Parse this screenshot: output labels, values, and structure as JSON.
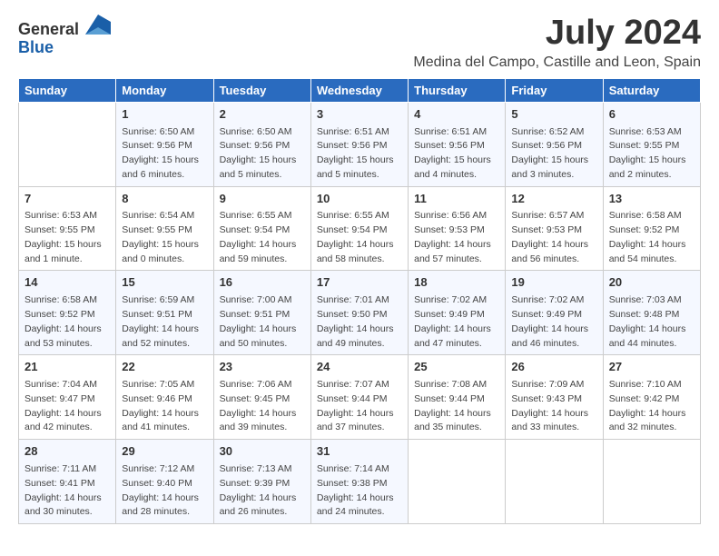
{
  "logo": {
    "general": "General",
    "blue": "Blue"
  },
  "title": "July 2024",
  "location": "Medina del Campo, Castille and Leon, Spain",
  "days_header": [
    "Sunday",
    "Monday",
    "Tuesday",
    "Wednesday",
    "Thursday",
    "Friday",
    "Saturday"
  ],
  "weeks": [
    [
      {
        "day": "",
        "sunrise": "",
        "sunset": "",
        "daylight": ""
      },
      {
        "day": "1",
        "sunrise": "Sunrise: 6:50 AM",
        "sunset": "Sunset: 9:56 PM",
        "daylight": "Daylight: 15 hours and 6 minutes."
      },
      {
        "day": "2",
        "sunrise": "Sunrise: 6:50 AM",
        "sunset": "Sunset: 9:56 PM",
        "daylight": "Daylight: 15 hours and 5 minutes."
      },
      {
        "day": "3",
        "sunrise": "Sunrise: 6:51 AM",
        "sunset": "Sunset: 9:56 PM",
        "daylight": "Daylight: 15 hours and 5 minutes."
      },
      {
        "day": "4",
        "sunrise": "Sunrise: 6:51 AM",
        "sunset": "Sunset: 9:56 PM",
        "daylight": "Daylight: 15 hours and 4 minutes."
      },
      {
        "day": "5",
        "sunrise": "Sunrise: 6:52 AM",
        "sunset": "Sunset: 9:56 PM",
        "daylight": "Daylight: 15 hours and 3 minutes."
      },
      {
        "day": "6",
        "sunrise": "Sunrise: 6:53 AM",
        "sunset": "Sunset: 9:55 PM",
        "daylight": "Daylight: 15 hours and 2 minutes."
      }
    ],
    [
      {
        "day": "7",
        "sunrise": "Sunrise: 6:53 AM",
        "sunset": "Sunset: 9:55 PM",
        "daylight": "Daylight: 15 hours and 1 minute."
      },
      {
        "day": "8",
        "sunrise": "Sunrise: 6:54 AM",
        "sunset": "Sunset: 9:55 PM",
        "daylight": "Daylight: 15 hours and 0 minutes."
      },
      {
        "day": "9",
        "sunrise": "Sunrise: 6:55 AM",
        "sunset": "Sunset: 9:54 PM",
        "daylight": "Daylight: 14 hours and 59 minutes."
      },
      {
        "day": "10",
        "sunrise": "Sunrise: 6:55 AM",
        "sunset": "Sunset: 9:54 PM",
        "daylight": "Daylight: 14 hours and 58 minutes."
      },
      {
        "day": "11",
        "sunrise": "Sunrise: 6:56 AM",
        "sunset": "Sunset: 9:53 PM",
        "daylight": "Daylight: 14 hours and 57 minutes."
      },
      {
        "day": "12",
        "sunrise": "Sunrise: 6:57 AM",
        "sunset": "Sunset: 9:53 PM",
        "daylight": "Daylight: 14 hours and 56 minutes."
      },
      {
        "day": "13",
        "sunrise": "Sunrise: 6:58 AM",
        "sunset": "Sunset: 9:52 PM",
        "daylight": "Daylight: 14 hours and 54 minutes."
      }
    ],
    [
      {
        "day": "14",
        "sunrise": "Sunrise: 6:58 AM",
        "sunset": "Sunset: 9:52 PM",
        "daylight": "Daylight: 14 hours and 53 minutes."
      },
      {
        "day": "15",
        "sunrise": "Sunrise: 6:59 AM",
        "sunset": "Sunset: 9:51 PM",
        "daylight": "Daylight: 14 hours and 52 minutes."
      },
      {
        "day": "16",
        "sunrise": "Sunrise: 7:00 AM",
        "sunset": "Sunset: 9:51 PM",
        "daylight": "Daylight: 14 hours and 50 minutes."
      },
      {
        "day": "17",
        "sunrise": "Sunrise: 7:01 AM",
        "sunset": "Sunset: 9:50 PM",
        "daylight": "Daylight: 14 hours and 49 minutes."
      },
      {
        "day": "18",
        "sunrise": "Sunrise: 7:02 AM",
        "sunset": "Sunset: 9:49 PM",
        "daylight": "Daylight: 14 hours and 47 minutes."
      },
      {
        "day": "19",
        "sunrise": "Sunrise: 7:02 AM",
        "sunset": "Sunset: 9:49 PM",
        "daylight": "Daylight: 14 hours and 46 minutes."
      },
      {
        "day": "20",
        "sunrise": "Sunrise: 7:03 AM",
        "sunset": "Sunset: 9:48 PM",
        "daylight": "Daylight: 14 hours and 44 minutes."
      }
    ],
    [
      {
        "day": "21",
        "sunrise": "Sunrise: 7:04 AM",
        "sunset": "Sunset: 9:47 PM",
        "daylight": "Daylight: 14 hours and 42 minutes."
      },
      {
        "day": "22",
        "sunrise": "Sunrise: 7:05 AM",
        "sunset": "Sunset: 9:46 PM",
        "daylight": "Daylight: 14 hours and 41 minutes."
      },
      {
        "day": "23",
        "sunrise": "Sunrise: 7:06 AM",
        "sunset": "Sunset: 9:45 PM",
        "daylight": "Daylight: 14 hours and 39 minutes."
      },
      {
        "day": "24",
        "sunrise": "Sunrise: 7:07 AM",
        "sunset": "Sunset: 9:44 PM",
        "daylight": "Daylight: 14 hours and 37 minutes."
      },
      {
        "day": "25",
        "sunrise": "Sunrise: 7:08 AM",
        "sunset": "Sunset: 9:44 PM",
        "daylight": "Daylight: 14 hours and 35 minutes."
      },
      {
        "day": "26",
        "sunrise": "Sunrise: 7:09 AM",
        "sunset": "Sunset: 9:43 PM",
        "daylight": "Daylight: 14 hours and 33 minutes."
      },
      {
        "day": "27",
        "sunrise": "Sunrise: 7:10 AM",
        "sunset": "Sunset: 9:42 PM",
        "daylight": "Daylight: 14 hours and 32 minutes."
      }
    ],
    [
      {
        "day": "28",
        "sunrise": "Sunrise: 7:11 AM",
        "sunset": "Sunset: 9:41 PM",
        "daylight": "Daylight: 14 hours and 30 minutes."
      },
      {
        "day": "29",
        "sunrise": "Sunrise: 7:12 AM",
        "sunset": "Sunset: 9:40 PM",
        "daylight": "Daylight: 14 hours and 28 minutes."
      },
      {
        "day": "30",
        "sunrise": "Sunrise: 7:13 AM",
        "sunset": "Sunset: 9:39 PM",
        "daylight": "Daylight: 14 hours and 26 minutes."
      },
      {
        "day": "31",
        "sunrise": "Sunrise: 7:14 AM",
        "sunset": "Sunset: 9:38 PM",
        "daylight": "Daylight: 14 hours and 24 minutes."
      },
      {
        "day": "",
        "sunrise": "",
        "sunset": "",
        "daylight": ""
      },
      {
        "day": "",
        "sunrise": "",
        "sunset": "",
        "daylight": ""
      },
      {
        "day": "",
        "sunrise": "",
        "sunset": "",
        "daylight": ""
      }
    ]
  ]
}
